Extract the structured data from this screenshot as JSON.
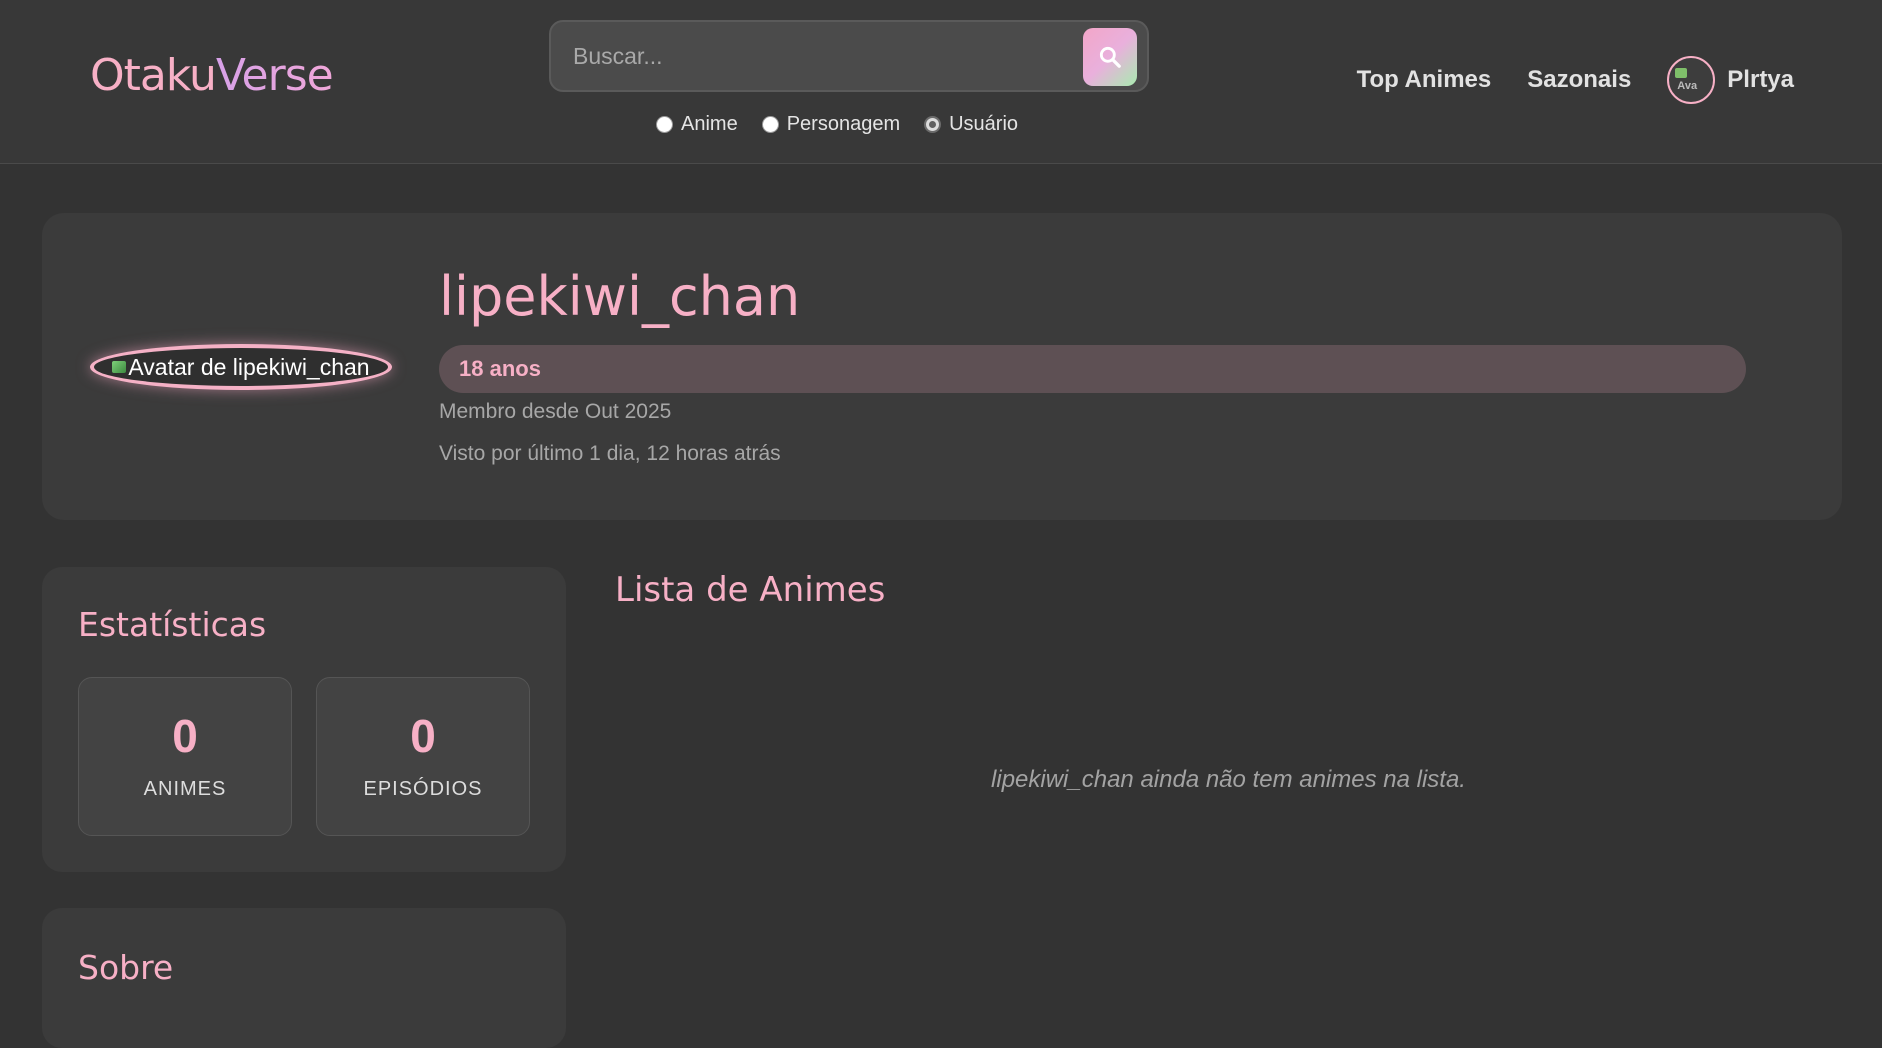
{
  "header": {
    "logo": {
      "part1": "Otaku",
      "part2": "Verse"
    },
    "search": {
      "placeholder": "Buscar...",
      "button_icon": "search-icon"
    },
    "search_types": [
      {
        "label": "Anime",
        "checked": false
      },
      {
        "label": "Personagem",
        "checked": false
      },
      {
        "label": "Usuário",
        "checked": true
      }
    ],
    "nav": {
      "top_animes": "Top Animes",
      "sazonais": "Sazonais",
      "user_name": "Plrtya",
      "user_avatar_alt": "Ava"
    }
  },
  "profile": {
    "avatar_alt": "Avatar de lipekiwi_chan",
    "username": "lipekiwi_chan",
    "age": "18 anos",
    "member_since": "Membro desde Out 2025",
    "last_seen": "Visto por último 1 dia, 12 horas atrás"
  },
  "stats": {
    "title": "Estatísticas",
    "items": [
      {
        "value": "0",
        "label": "ANIMES"
      },
      {
        "value": "0",
        "label": "EPISÓDIOS"
      }
    ]
  },
  "about": {
    "title": "Sobre"
  },
  "anime_list": {
    "title": "Lista de Animes",
    "empty_message": "lipekiwi_chan ainda não tem animes na lista."
  },
  "colors": {
    "accent_pink": "#f7b0c6",
    "background": "#333333",
    "card": "#3b3b3b"
  }
}
